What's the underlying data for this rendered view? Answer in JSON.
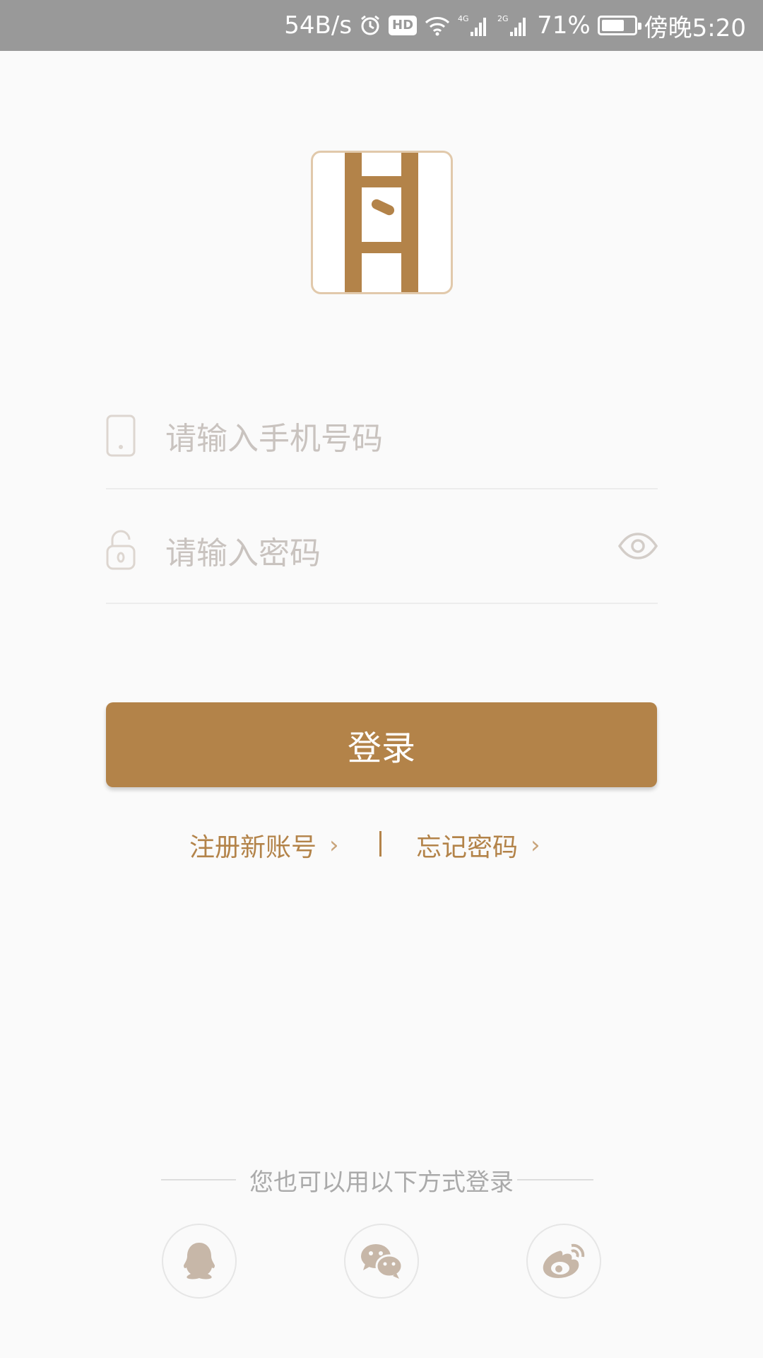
{
  "status_bar": {
    "speed": "54B/s",
    "hd": "HD",
    "net1": "4G",
    "net2": "2G",
    "battery": "71%",
    "battery_level": 0.71,
    "time": "傍晚5:20"
  },
  "login": {
    "phone_placeholder": "请输入手机号码",
    "password_placeholder": "请输入密码",
    "button_label": "登录",
    "register_label": "注册新账号",
    "forgot_label": "忘记密码",
    "chevron": "›"
  },
  "alt_login": {
    "title": "您也可以用以下方式登录",
    "providers": [
      "qq-icon",
      "wechat-icon",
      "weibo-icon"
    ]
  },
  "colors": {
    "accent": "#b38349",
    "statusbar": "#999999",
    "background": "#fafafa",
    "placeholder": "#c9c3bf",
    "social_icon": "#c7b7a8"
  }
}
